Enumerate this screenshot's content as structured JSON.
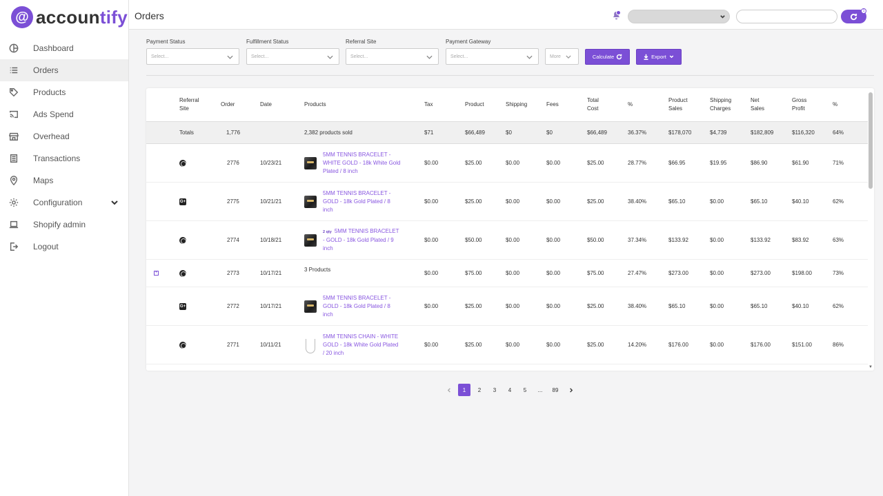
{
  "brand": {
    "name_part1": "accoun",
    "name_part2": "tify",
    "mark": "@"
  },
  "sidebar": {
    "items": [
      {
        "label": "Dashboard",
        "icon": "dashboard-icon"
      },
      {
        "label": "Orders",
        "icon": "list-icon",
        "active": true
      },
      {
        "label": "Products",
        "icon": "tag-icon"
      },
      {
        "label": "Ads Spend",
        "icon": "cast-icon"
      },
      {
        "label": "Overhead",
        "icon": "store-icon"
      },
      {
        "label": "Transactions",
        "icon": "receipt-icon"
      },
      {
        "label": "Maps",
        "icon": "map-pin-icon"
      },
      {
        "label": "Configuration",
        "icon": "gear-icon"
      },
      {
        "label": "Shopify admin",
        "icon": "laptop-icon"
      },
      {
        "label": "Logout",
        "icon": "logout-icon"
      }
    ]
  },
  "header": {
    "title": "Orders",
    "notification_badge": "0",
    "refresh_badge": "1"
  },
  "filters": {
    "payment_status": {
      "label": "Payment Status",
      "placeholder": "Select..."
    },
    "fulfillment_status": {
      "label": "Fulfillment Status",
      "placeholder": "Select..."
    },
    "referral_site": {
      "label": "Referral Site",
      "placeholder": "Select..."
    },
    "payment_gateway": {
      "label": "Payment Gateway",
      "placeholder": "Select..."
    },
    "more_label": "More",
    "calculate_label": "Calculate",
    "export_label": "Export"
  },
  "table": {
    "headers": {
      "referral_site_1": "Referral",
      "referral_site_2": "Site",
      "order": "Order",
      "date": "Date",
      "products": "Products",
      "tax": "Tax",
      "product": "Product",
      "shipping": "Shipping",
      "fees": "Fees",
      "total_cost_1": "Total",
      "total_cost_2": "Cost",
      "pct1": "%",
      "product_sales_1": "Product",
      "product_sales_2": "Sales",
      "shipping_charges_1": "Shipping",
      "shipping_charges_2": "Charges",
      "net_sales_1": "Net",
      "net_sales_2": "Sales",
      "gross_profit_1": "Gross",
      "gross_profit_2": "Profit",
      "pct2": "%"
    },
    "totals": {
      "label": "Totals",
      "order": "1,776",
      "products": "2,382 products sold",
      "tax": "$71",
      "product": "$66,489",
      "shipping": "$0",
      "fees": "$0",
      "total_cost": "$66,489",
      "pct1": "36.37%",
      "product_sales": "$178,070",
      "shipping_charges": "$4,739",
      "net_sales": "$182,809",
      "gross_profit": "$116,320",
      "pct2": "64%"
    },
    "rows": [
      {
        "site": "globe",
        "order": "2776",
        "date": "10/23/21",
        "qty": "",
        "product": "5MM TENNIS BRACELET - WHITE GOLD - 18k White Gold Plated / 8 inch",
        "thumb": "box",
        "tax": "$0.00",
        "product_cost": "$25.00",
        "shipping": "$0.00",
        "fees": "$0.00",
        "total_cost": "$25.00",
        "pct1": "28.77%",
        "product_sales": "$66.95",
        "shipping_charges": "$19.95",
        "net_sales": "$86.90",
        "gross_profit": "$61.90",
        "pct2": "71%"
      },
      {
        "site": "google",
        "order": "2775",
        "date": "10/21/21",
        "qty": "",
        "product": "5MM TENNIS BRACELET - GOLD - 18k Gold Plated / 8 inch",
        "thumb": "box",
        "tax": "$0.00",
        "product_cost": "$25.00",
        "shipping": "$0.00",
        "fees": "$0.00",
        "total_cost": "$25.00",
        "pct1": "38.40%",
        "product_sales": "$65.10",
        "shipping_charges": "$0.00",
        "net_sales": "$65.10",
        "gross_profit": "$40.10",
        "pct2": "62%"
      },
      {
        "site": "globe",
        "order": "2774",
        "date": "10/18/21",
        "qty": "2 qty",
        "product": "5MM TENNIS BRACELET - GOLD - 18k Gold Plated / 9 inch",
        "thumb": "box",
        "tax": "$0.00",
        "product_cost": "$50.00",
        "shipping": "$0.00",
        "fees": "$0.00",
        "total_cost": "$50.00",
        "pct1": "37.34%",
        "product_sales": "$133.92",
        "shipping_charges": "$0.00",
        "net_sales": "$133.92",
        "gross_profit": "$83.92",
        "pct2": "63%"
      },
      {
        "site": "globe",
        "order": "2773",
        "date": "10/17/21",
        "qty": "",
        "product": "3 Products",
        "thumb": "none",
        "expandable": true,
        "tax": "$0.00",
        "product_cost": "$75.00",
        "shipping": "$0.00",
        "fees": "$0.00",
        "total_cost": "$75.00",
        "pct1": "27.47%",
        "product_sales": "$273.00",
        "shipping_charges": "$0.00",
        "net_sales": "$273.00",
        "gross_profit": "$198.00",
        "pct2": "73%"
      },
      {
        "site": "google",
        "order": "2772",
        "date": "10/17/21",
        "qty": "",
        "product": "5MM TENNIS BRACELET - GOLD - 18k Gold Plated / 8 inch",
        "thumb": "box",
        "tax": "$0.00",
        "product_cost": "$25.00",
        "shipping": "$0.00",
        "fees": "$0.00",
        "total_cost": "$25.00",
        "pct1": "38.40%",
        "product_sales": "$65.10",
        "shipping_charges": "$0.00",
        "net_sales": "$65.10",
        "gross_profit": "$40.10",
        "pct2": "62%"
      },
      {
        "site": "globe",
        "order": "2771",
        "date": "10/11/21",
        "qty": "",
        "product": "5MM TENNIS CHAIN - WHITE GOLD - 18k White Gold Plated / 20 inch",
        "thumb": "chain",
        "tax": "$0.00",
        "product_cost": "$25.00",
        "shipping": "$0.00",
        "fees": "$0.00",
        "total_cost": "$25.00",
        "pct1": "14.20%",
        "product_sales": "$176.00",
        "shipping_charges": "$0.00",
        "net_sales": "$176.00",
        "gross_profit": "$151.00",
        "pct2": "86%"
      }
    ]
  },
  "pagination": {
    "pages": [
      "1",
      "2",
      "3",
      "4",
      "5",
      "...",
      "89"
    ],
    "current": "1"
  },
  "colors": {
    "accent": "#7b4fd6",
    "link": "#8856e0"
  }
}
